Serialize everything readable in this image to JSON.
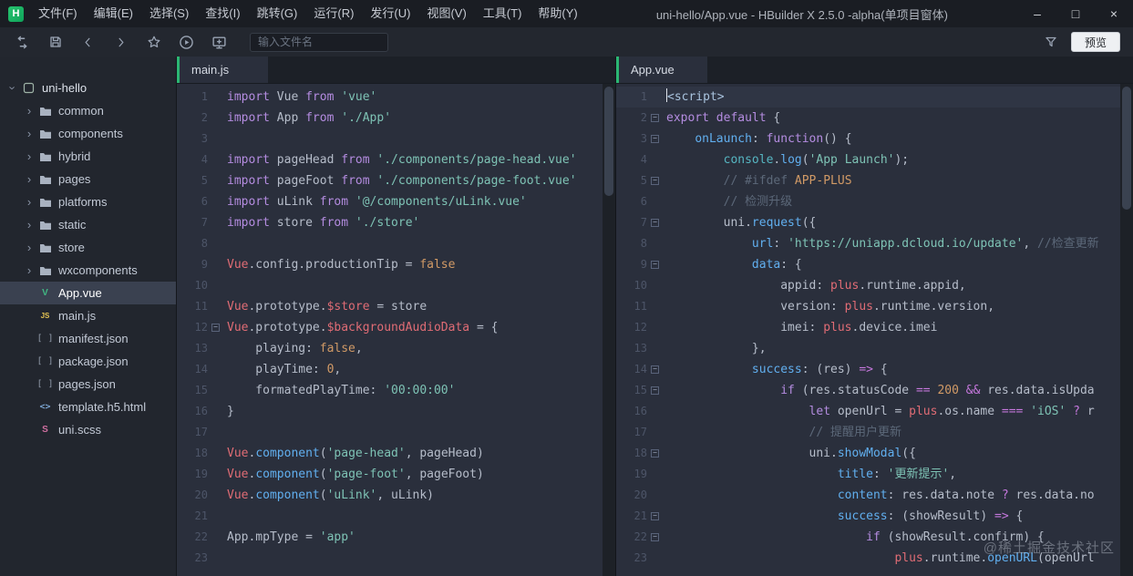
{
  "window": {
    "logo_letter": "H",
    "title": "uni-hello/App.vue - HBuilder X 2.5.0 -alpha(单项目窗体)",
    "controls": {
      "minimize": "–",
      "maximize": "□",
      "close": "×"
    }
  },
  "menu": {
    "items": [
      "文件(F)",
      "编辑(E)",
      "选择(S)",
      "查找(I)",
      "跳转(G)",
      "运行(R)",
      "发行(U)",
      "视图(V)",
      "工具(T)",
      "帮助(Y)"
    ]
  },
  "toolbar": {
    "icons": [
      "window-switch",
      "save",
      "back",
      "forward",
      "favorite",
      "run",
      "open-in-browser",
      "filter"
    ],
    "file_input_placeholder": "输入文件名",
    "preview_label": "预览"
  },
  "sidebar": {
    "project": "uni-hello",
    "items": [
      {
        "label": "uni-hello",
        "kind": "project"
      },
      {
        "label": "common",
        "kind": "folder"
      },
      {
        "label": "components",
        "kind": "folder"
      },
      {
        "label": "hybrid",
        "kind": "folder"
      },
      {
        "label": "pages",
        "kind": "folder"
      },
      {
        "label": "platforms",
        "kind": "folder"
      },
      {
        "label": "static",
        "kind": "folder"
      },
      {
        "label": "store",
        "kind": "folder"
      },
      {
        "label": "wxcomponents",
        "kind": "folder"
      },
      {
        "label": "App.vue",
        "kind": "file",
        "icon": "vue",
        "selected": true
      },
      {
        "label": "main.js",
        "kind": "file",
        "icon": "js"
      },
      {
        "label": "manifest.json",
        "kind": "file",
        "icon": "json"
      },
      {
        "label": "package.json",
        "kind": "file",
        "icon": "json"
      },
      {
        "label": "pages.json",
        "kind": "file",
        "icon": "json"
      },
      {
        "label": "template.h5.html",
        "kind": "file",
        "icon": "html"
      },
      {
        "label": "uni.scss",
        "kind": "file",
        "icon": "scss"
      }
    ]
  },
  "editors": [
    {
      "tab": "main.js",
      "lines": [
        {
          "n": 1,
          "segs": [
            [
              "k",
              "import"
            ],
            [
              "p",
              " Vue "
            ],
            [
              "k",
              "from"
            ],
            [
              "p",
              " "
            ],
            [
              "s",
              "'vue'"
            ]
          ]
        },
        {
          "n": 2,
          "segs": [
            [
              "k",
              "import"
            ],
            [
              "p",
              " App "
            ],
            [
              "k",
              "from"
            ],
            [
              "p",
              " "
            ],
            [
              "s",
              "'./App'"
            ]
          ]
        },
        {
          "n": 3,
          "segs": []
        },
        {
          "n": 4,
          "segs": [
            [
              "k",
              "import"
            ],
            [
              "p",
              " pageHead "
            ],
            [
              "k",
              "from"
            ],
            [
              "p",
              " "
            ],
            [
              "s",
              "'./components/page-head.vue'"
            ]
          ]
        },
        {
          "n": 5,
          "segs": [
            [
              "k",
              "import"
            ],
            [
              "p",
              " pageFoot "
            ],
            [
              "k",
              "from"
            ],
            [
              "p",
              " "
            ],
            [
              "s",
              "'./components/page-foot.vue'"
            ]
          ]
        },
        {
          "n": 6,
          "segs": [
            [
              "k",
              "import"
            ],
            [
              "p",
              " uLink "
            ],
            [
              "k",
              "from"
            ],
            [
              "p",
              " "
            ],
            [
              "s",
              "'@/components/uLink.vue'"
            ]
          ]
        },
        {
          "n": 7,
          "segs": [
            [
              "k",
              "import"
            ],
            [
              "p",
              " store "
            ],
            [
              "k",
              "from"
            ],
            [
              "p",
              " "
            ],
            [
              "s",
              "'./store'"
            ]
          ]
        },
        {
          "n": 8,
          "segs": []
        },
        {
          "n": 9,
          "segs": [
            [
              "cls",
              "Vue"
            ],
            [
              "p",
              ".config.productionTip = "
            ],
            [
              "n",
              "false"
            ]
          ]
        },
        {
          "n": 10,
          "segs": []
        },
        {
          "n": 11,
          "segs": [
            [
              "cls",
              "Vue"
            ],
            [
              "p",
              ".prototype."
            ],
            [
              "cls",
              "$store"
            ],
            [
              "p",
              " = store"
            ]
          ]
        },
        {
          "n": 12,
          "fold": true,
          "segs": [
            [
              "cls",
              "Vue"
            ],
            [
              "p",
              ".prototype."
            ],
            [
              "cls",
              "$backgroundAudioData"
            ],
            [
              "p",
              " = {"
            ]
          ]
        },
        {
          "n": 13,
          "segs": [
            [
              "p",
              "    playing: "
            ],
            [
              "n",
              "false"
            ],
            [
              "p",
              ","
            ]
          ]
        },
        {
          "n": 14,
          "segs": [
            [
              "p",
              "    playTime: "
            ],
            [
              "n",
              "0"
            ],
            [
              "p",
              ","
            ]
          ]
        },
        {
          "n": 15,
          "segs": [
            [
              "p",
              "    formatedPlayTime: "
            ],
            [
              "s",
              "'00:00:00'"
            ]
          ]
        },
        {
          "n": 16,
          "segs": [
            [
              "p",
              "}"
            ]
          ]
        },
        {
          "n": 17,
          "segs": []
        },
        {
          "n": 18,
          "segs": [
            [
              "cls",
              "Vue"
            ],
            [
              "p",
              "."
            ],
            [
              "f",
              "component"
            ],
            [
              "p",
              "("
            ],
            [
              "s",
              "'page-head'"
            ],
            [
              "p",
              ", pageHead)"
            ]
          ]
        },
        {
          "n": 19,
          "segs": [
            [
              "cls",
              "Vue"
            ],
            [
              "p",
              "."
            ],
            [
              "f",
              "component"
            ],
            [
              "p",
              "("
            ],
            [
              "s",
              "'page-foot'"
            ],
            [
              "p",
              ", pageFoot)"
            ]
          ]
        },
        {
          "n": 20,
          "segs": [
            [
              "cls",
              "Vue"
            ],
            [
              "p",
              "."
            ],
            [
              "f",
              "component"
            ],
            [
              "p",
              "("
            ],
            [
              "s",
              "'uLink'"
            ],
            [
              "p",
              ", uLink)"
            ]
          ]
        },
        {
          "n": 21,
          "segs": []
        },
        {
          "n": 22,
          "segs": [
            [
              "p",
              "App.mpType = "
            ],
            [
              "s",
              "'app'"
            ]
          ]
        },
        {
          "n": 23,
          "segs": []
        }
      ]
    },
    {
      "tab": "App.vue",
      "lines": [
        {
          "n": 1,
          "cursor": true,
          "active": true,
          "segs": [
            [
              "tag",
              "<script>"
            ]
          ]
        },
        {
          "n": 2,
          "fold": true,
          "segs": [
            [
              "k",
              "export"
            ],
            [
              "p",
              " "
            ],
            [
              "k",
              "default"
            ],
            [
              "p",
              " {"
            ]
          ]
        },
        {
          "n": 3,
          "fold": true,
          "segs": [
            [
              "p",
              "    "
            ],
            [
              "key",
              "onLaunch"
            ],
            [
              "p",
              ": "
            ],
            [
              "k",
              "function"
            ],
            [
              "p",
              "() {"
            ]
          ]
        },
        {
          "n": 4,
          "segs": [
            [
              "p",
              "        "
            ],
            [
              "gbl",
              "console"
            ],
            [
              "p",
              "."
            ],
            [
              "f",
              "log"
            ],
            [
              "p",
              "("
            ],
            [
              "s",
              "'App Launch'"
            ],
            [
              "p",
              ");"
            ]
          ]
        },
        {
          "n": 5,
          "fold": true,
          "segs": [
            [
              "p",
              "        "
            ],
            [
              "c",
              "// #ifdef "
            ],
            [
              "cd",
              "APP-PLUS"
            ]
          ]
        },
        {
          "n": 6,
          "segs": [
            [
              "p",
              "        "
            ],
            [
              "c",
              "// 检测升级"
            ]
          ]
        },
        {
          "n": 7,
          "fold": true,
          "segs": [
            [
              "p",
              "        uni."
            ],
            [
              "f",
              "request"
            ],
            [
              "p",
              "({"
            ]
          ]
        },
        {
          "n": 8,
          "segs": [
            [
              "p",
              "            "
            ],
            [
              "key",
              "url"
            ],
            [
              "p",
              ": "
            ],
            [
              "s",
              "'https://uniapp.dcloud.io/update'"
            ],
            [
              "p",
              ", "
            ],
            [
              "c",
              "//检查更新"
            ]
          ]
        },
        {
          "n": 9,
          "fold": true,
          "segs": [
            [
              "p",
              "            "
            ],
            [
              "key",
              "data"
            ],
            [
              "p",
              ": {"
            ]
          ]
        },
        {
          "n": 10,
          "segs": [
            [
              "p",
              "                appid: "
            ],
            [
              "cls",
              "plus"
            ],
            [
              "p",
              ".runtime.appid,"
            ]
          ]
        },
        {
          "n": 11,
          "segs": [
            [
              "p",
              "                version: "
            ],
            [
              "cls",
              "plus"
            ],
            [
              "p",
              ".runtime.version,"
            ]
          ]
        },
        {
          "n": 12,
          "segs": [
            [
              "p",
              "                imei: "
            ],
            [
              "cls",
              "plus"
            ],
            [
              "p",
              ".device.imei"
            ]
          ]
        },
        {
          "n": 13,
          "segs": [
            [
              "p",
              "            },"
            ]
          ]
        },
        {
          "n": 14,
          "fold": true,
          "segs": [
            [
              "p",
              "            "
            ],
            [
              "key",
              "success"
            ],
            [
              "p",
              ": (res) "
            ],
            [
              "o",
              "=>"
            ],
            [
              "p",
              " {"
            ]
          ]
        },
        {
          "n": 15,
          "fold": true,
          "segs": [
            [
              "p",
              "                "
            ],
            [
              "k",
              "if"
            ],
            [
              "p",
              " (res.statusCode "
            ],
            [
              "o",
              "=="
            ],
            [
              "p",
              " "
            ],
            [
              "n",
              "200"
            ],
            [
              "p",
              " "
            ],
            [
              "o",
              "&&"
            ],
            [
              "p",
              " res.data.isUpda"
            ]
          ]
        },
        {
          "n": 16,
          "segs": [
            [
              "p",
              "                    "
            ],
            [
              "k",
              "let"
            ],
            [
              "p",
              " openUrl = "
            ],
            [
              "cls",
              "plus"
            ],
            [
              "p",
              ".os.name "
            ],
            [
              "o",
              "==="
            ],
            [
              "p",
              " "
            ],
            [
              "s",
              "'iOS'"
            ],
            [
              "p",
              " "
            ],
            [
              "o",
              "?"
            ],
            [
              "p",
              " r"
            ]
          ]
        },
        {
          "n": 17,
          "segs": [
            [
              "p",
              "                    "
            ],
            [
              "c",
              "// 提醒用户更新"
            ]
          ]
        },
        {
          "n": 18,
          "fold": true,
          "segs": [
            [
              "p",
              "                    uni."
            ],
            [
              "f",
              "showModal"
            ],
            [
              "p",
              "({"
            ]
          ]
        },
        {
          "n": 19,
          "segs": [
            [
              "p",
              "                        "
            ],
            [
              "key",
              "title"
            ],
            [
              "p",
              ": "
            ],
            [
              "s",
              "'更新提示'"
            ],
            [
              "p",
              ","
            ]
          ]
        },
        {
          "n": 20,
          "segs": [
            [
              "p",
              "                        "
            ],
            [
              "key",
              "content"
            ],
            [
              "p",
              ": res.data.note "
            ],
            [
              "o",
              "?"
            ],
            [
              "p",
              " res.data.no"
            ]
          ]
        },
        {
          "n": 21,
          "fold": true,
          "segs": [
            [
              "p",
              "                        "
            ],
            [
              "key",
              "success"
            ],
            [
              "p",
              ": (showResult) "
            ],
            [
              "o",
              "=>"
            ],
            [
              "p",
              " {"
            ]
          ]
        },
        {
          "n": 22,
          "fold": true,
          "segs": [
            [
              "p",
              "                            "
            ],
            [
              "k",
              "if"
            ],
            [
              "p",
              " (showResult.confirm) {"
            ]
          ]
        },
        {
          "n": 23,
          "segs": [
            [
              "p",
              "                                "
            ],
            [
              "cls",
              "plus"
            ],
            [
              "p",
              ".runtime."
            ],
            [
              "f",
              "openURL"
            ],
            [
              "p",
              "(openUrl"
            ]
          ]
        }
      ]
    }
  ],
  "watermark": {
    "text": "@稀土掘金技术社区"
  },
  "colors": {
    "accent_green": "#2bb673",
    "logo_green": "#1cbf6e",
    "editor_bg": "#2a2f3c",
    "sidebar_bg": "#22262e",
    "titlebar_bg": "#1a1d23",
    "selection_bg": "#3a4150",
    "keyword": "#b48ce0",
    "string": "#7ec3b5",
    "number": "#d19a66",
    "comment": "#5c6879",
    "function": "#61afef",
    "class_ident": "#e06c75"
  }
}
